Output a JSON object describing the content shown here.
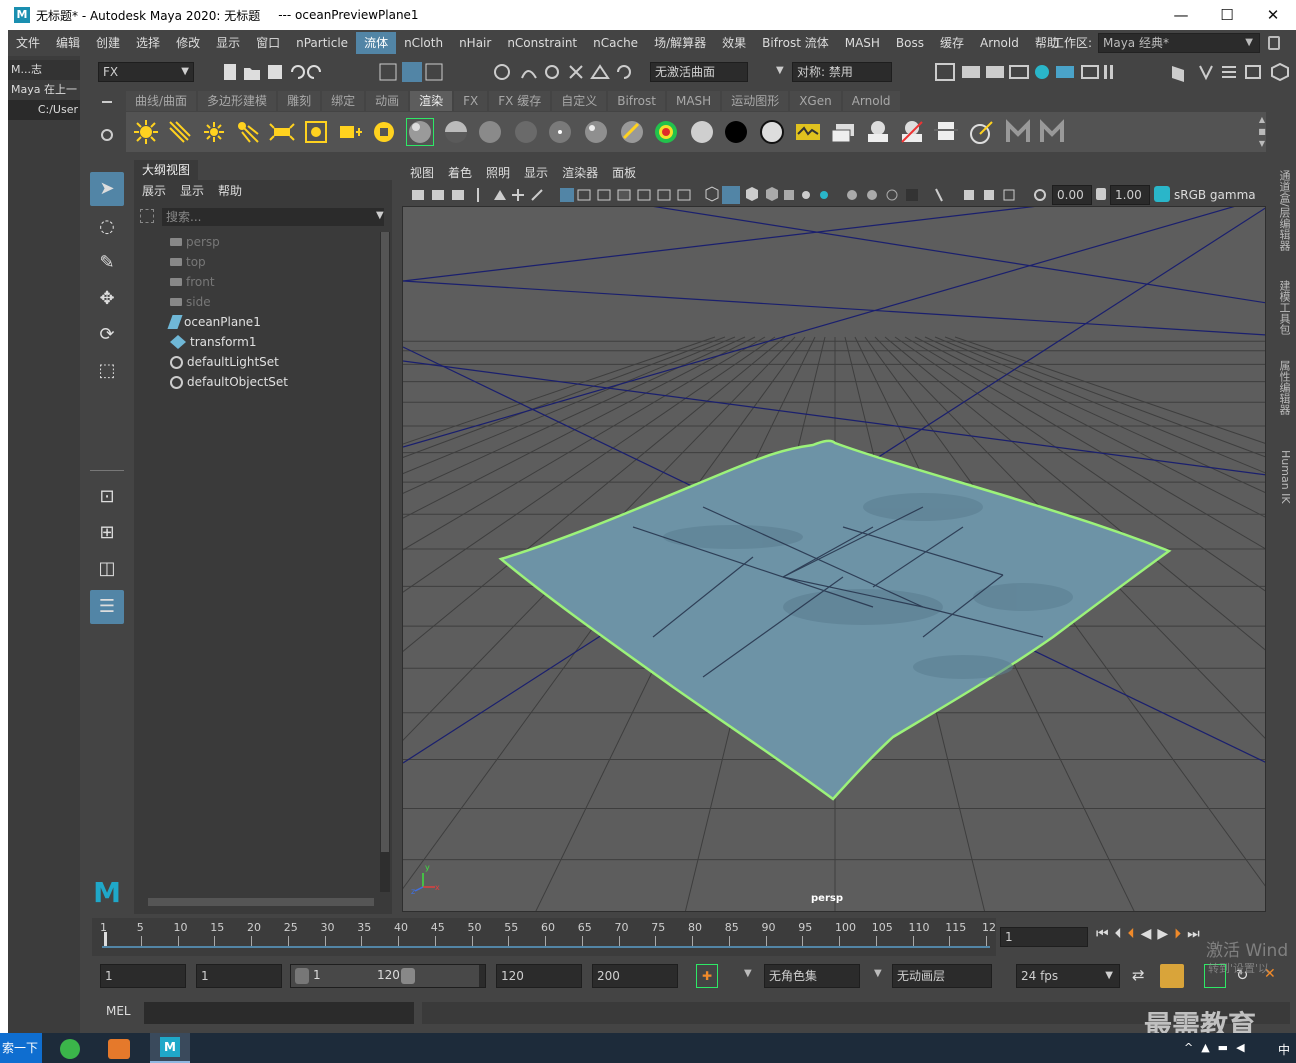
{
  "window": {
    "title": "无标题* - Autodesk Maya 2020: 无标题",
    "title2": "---    oceanPreviewPlane1",
    "logo": "M",
    "minimize": "—",
    "maximize": "☐",
    "close": "✕"
  },
  "bg_panel": {
    "header": "M...志",
    "row1": "Maya 在上一",
    "row2": "C:/User"
  },
  "menubar": {
    "items": [
      "文件",
      "编辑",
      "创建",
      "选择",
      "修改",
      "显示",
      "窗口",
      "nParticle",
      "流体",
      "nCloth",
      "nHair",
      "nConstraint",
      "nCache",
      "场/解算器",
      "效果",
      "Bifrost 流体",
      "MASH",
      "Boss",
      "缓存",
      "Arnold",
      "帮助"
    ],
    "active_index": 8,
    "workspace_label": "工作区:",
    "workspace_value": "Maya 经典*"
  },
  "statusline": {
    "menuset": "FX",
    "live_surface": "无激活曲面",
    "symmetry": "对称: 禁用"
  },
  "shelf": {
    "tabs": [
      "曲线/曲面",
      "多边形建模",
      "雕刻",
      "绑定",
      "动画",
      "渲染",
      "FX",
      "FX 缓存",
      "自定义",
      "Bifrost",
      "MASH",
      "运动图形",
      "XGen",
      "Arnold"
    ],
    "active_tab": 5
  },
  "outliner": {
    "title": "大纲视图",
    "menu": [
      "展示",
      "显示",
      "帮助"
    ],
    "search_placeholder": "搜索...",
    "items": [
      {
        "label": "persp",
        "icon": "camera-icon",
        "dim": true
      },
      {
        "label": "top",
        "icon": "camera-icon",
        "dim": true
      },
      {
        "label": "front",
        "icon": "camera-icon",
        "dim": true
      },
      {
        "label": "side",
        "icon": "camera-icon",
        "dim": true
      },
      {
        "label": "oceanPlane1",
        "icon": "ocean-plane-icon",
        "dim": false
      },
      {
        "label": "transform1",
        "icon": "transform-icon",
        "dim": false
      },
      {
        "label": "defaultLightSet",
        "icon": "set-icon",
        "dim": false
      },
      {
        "label": "defaultObjectSet",
        "icon": "set-icon",
        "dim": false
      }
    ]
  },
  "viewport": {
    "menu": [
      "视图",
      "着色",
      "照明",
      "显示",
      "渲染器",
      "面板"
    ],
    "exposure": "0.00",
    "gamma": "1.00",
    "color_space": "sRGB gamma",
    "camera_label": "persp",
    "axis_y": "y",
    "axis_x": "x",
    "axis_z": "z",
    "colors": {
      "background": "#5d5d5d",
      "ocean": "#6d93a6",
      "ocean_edge": "#9cf27a",
      "axis_lines": "#1a1f6e"
    }
  },
  "side_tabs": [
    "通道盒/层编辑器",
    "建模工具包",
    "属性编辑器",
    "Human IK"
  ],
  "timeslider": {
    "ticks": [
      "1",
      "5",
      "10",
      "15",
      "20",
      "25",
      "30",
      "35",
      "40",
      "45",
      "50",
      "55",
      "60",
      "65",
      "70",
      "75",
      "80",
      "85",
      "90",
      "95",
      "100",
      "105",
      "110",
      "115",
      "12"
    ],
    "current_frame": "1"
  },
  "rangeslider": {
    "start": "1",
    "playback_start": "1",
    "range_start": "1",
    "range_end": "120",
    "playback_end": "120",
    "end": "200",
    "character_set": "无角色集",
    "anim_layer": "无动画层",
    "fps": "24 fps"
  },
  "cmdline": {
    "label": "MEL"
  },
  "taskbar": {
    "search": "索一下",
    "time_lang": "中"
  },
  "watermarks": {
    "activate": "激活 Wind",
    "activate_sub": "转到'设置'以",
    "brand": "最需教育"
  }
}
